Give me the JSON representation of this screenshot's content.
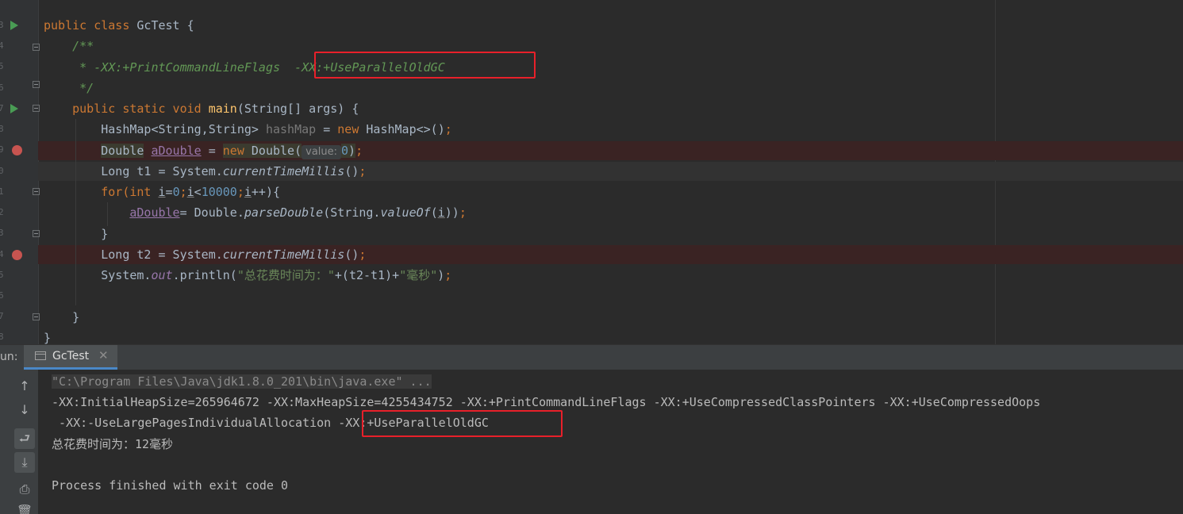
{
  "editor": {
    "lines": {
      "l1_kw1": "public",
      "l1_kw2": "class",
      "l1_name": "GcTest",
      "l1_brace": "{",
      "l2": "/**",
      "l3_prefix": " * -XX:+PrintCommandLineFlags ",
      "l3_flag": "-XX:+UseParallelOldGC",
      "l4": " */",
      "l5_kw": "public static void",
      "l5_fn": "main",
      "l5_rest": "(String[] args) {",
      "l6_type": "HashMap<String,String>",
      "l6_var": "hashMap",
      "l6_eq": " = ",
      "l6_new": "new",
      "l6_rest": " HashMap<>()",
      "l6_semi": ";",
      "l7_type": "Double",
      "l7_var": "aDouble",
      "l7_eq": " = ",
      "l7_new": "new",
      "l7_call": " Double(",
      "l7_hint": "value:",
      "l7_num": "0",
      "l7_close": ")",
      "l7_semi": ";",
      "l8_a": "Long t1 = System.",
      "l8_m": "currentTimeMillis",
      "l8_b": "()",
      "l8_semi": ";",
      "l9_for": "for(",
      "l9_int": "int",
      "l9_i1": "i",
      "l9_eq": "=",
      "l9_zero": "0",
      "l9_semi1": ";",
      "l9_i2": "i",
      "l9_lt": "<",
      "l9_max": "10000",
      "l9_semi2": ";",
      "l9_i3": "i",
      "l9_end": "++){",
      "l10_var": "aDouble",
      "l10_a": "= Double.",
      "l10_m": "parseDouble",
      "l10_b": "(String.",
      "l10_m2": "valueOf",
      "l10_c": "(",
      "l10_i": "i",
      "l10_d": "))",
      "l10_semi": ";",
      "l11": "}",
      "l12_a": "Long t2 = System.",
      "l12_m": "currentTimeMillis",
      "l12_b": "()",
      "l12_semi": ";",
      "l13_a": "System.",
      "l13_out": "out",
      "l13_b": ".println(",
      "l13_s1": "\"总花费时间为：\"",
      "l13_c": "+(t2-t1)+",
      "l13_s2": "\"毫秒\"",
      "l13_d": ")",
      "l13_semi": ";",
      "l15": "}",
      "l16": "}"
    },
    "gutter_numbers": [
      "3",
      "4",
      "5",
      "6",
      "7",
      "8",
      "9",
      "0",
      "1",
      "2",
      "3",
      "4",
      "5",
      "6",
      "7",
      "8"
    ]
  },
  "run": {
    "panel_label": "un:",
    "tab_label": "GcTest",
    "tab_close": "✕",
    "toolbar": {
      "up": "↑",
      "down": "↓",
      "wrap": "⮐",
      "scroll_end": "⤓",
      "print": "⎙",
      "trash": "🗑"
    },
    "console": [
      "\"C:\\Program Files\\Java\\jdk1.8.0_201\\bin\\java.exe\" ...",
      "-XX:InitialHeapSize=265964672 -XX:MaxHeapSize=4255434752 -XX:+PrintCommandLineFlags -XX:+UseCompressedClassPointers -XX:+UseCompressedOops",
      " -XX:-UseLargePagesIndividualAllocation ",
      "-XX:+UseParallelOldGC",
      "总花费时间为：12毫秒",
      "Process finished with exit code 0"
    ]
  },
  "colors": {
    "keyword": "#cc7832",
    "comment": "#629755",
    "number": "#6897bb",
    "function": "#ffc66d",
    "annotation_box": "#e8202a",
    "breakpoint": "#c75450",
    "run_icon": "#499c54"
  },
  "icons": [
    "run-gutter-icon",
    "breakpoint-icon",
    "fold-icon",
    "console-tab-icon",
    "close-icon",
    "up-arrow-icon",
    "down-arrow-icon",
    "soft-wrap-icon",
    "scroll-to-end-icon",
    "print-icon",
    "trash-icon"
  ]
}
